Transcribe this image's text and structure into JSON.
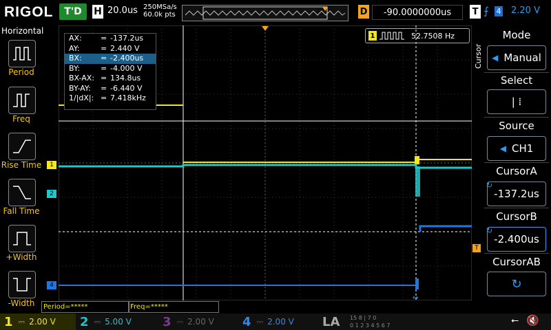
{
  "topbar": {
    "logo": "RIGOL",
    "run_state": "T'D",
    "h_label": "H",
    "timebase": "20.0us",
    "sample_rate": "250MSa/s",
    "mem_depth": "60.0k pts",
    "d_label": "D",
    "delay": "-90.0000000us",
    "t_label": "T",
    "trigger_source": "4",
    "trigger_level": "2.20 V"
  },
  "left_menu": {
    "title": "Horizontal",
    "items": [
      {
        "label": "Period"
      },
      {
        "label": "Freq"
      },
      {
        "label": "Rise Time"
      },
      {
        "label": "Fall Time"
      },
      {
        "label": "+Width"
      },
      {
        "label": "-Width"
      }
    ]
  },
  "cursor_table": {
    "rows": [
      {
        "key": "AX:",
        "value": "-137.2us"
      },
      {
        "key": "AY:",
        "value": "2.440 V"
      },
      {
        "key": "BX:",
        "value": "-2.400us"
      },
      {
        "key": "BY:",
        "value": "-4.000 V"
      },
      {
        "key": "BX-AX:",
        "value": "134.8us"
      },
      {
        "key": "BY-AY:",
        "value": "-6.440 V"
      },
      {
        "key": "1/|dX|:",
        "value": "7.418kHz"
      }
    ],
    "eq": "="
  },
  "freq_counter": {
    "channel": "1",
    "value": "52.7508 Hz"
  },
  "right_menu": {
    "side_tab": "Cursor",
    "mode_label": "Mode",
    "mode_value": "Manual",
    "select_label": "Select",
    "select_value": "|   ⁞",
    "source_label": "Source",
    "source_value": "CH1",
    "cursor_a_label": "CursorA",
    "cursor_a_value": "-137.2us",
    "cursor_b_label": "CursorB",
    "cursor_b_value": "-2.400us",
    "cursor_ab_label": "CursorAB"
  },
  "markers": {
    "ch1": "1",
    "ch2": "2",
    "ch4": "4",
    "trig": "T"
  },
  "measure_results": {
    "period": "Period=*****",
    "freq": "Freq=*****"
  },
  "bottombar": {
    "channels": [
      {
        "num": "1",
        "scale": "2.00 V",
        "color": "#f3e61c"
      },
      {
        "num": "2",
        "scale": "5.00 V",
        "color": "#1ec8c8"
      },
      {
        "num": "3",
        "scale": "2.00 V",
        "color": "#7a3b8a"
      },
      {
        "num": "4",
        "scale": "2.00 V",
        "color": "#2d8bf0"
      }
    ],
    "la_label": "LA",
    "la_bits_1": "15 8 | 7 0",
    "la_bits_2": "0 1 2 3 4 5 6 7"
  },
  "colors": {
    "ch1": "#f3e61c",
    "ch2": "#1ec8c8",
    "ch4": "#1f78e0",
    "accent": "#f3a31c"
  }
}
